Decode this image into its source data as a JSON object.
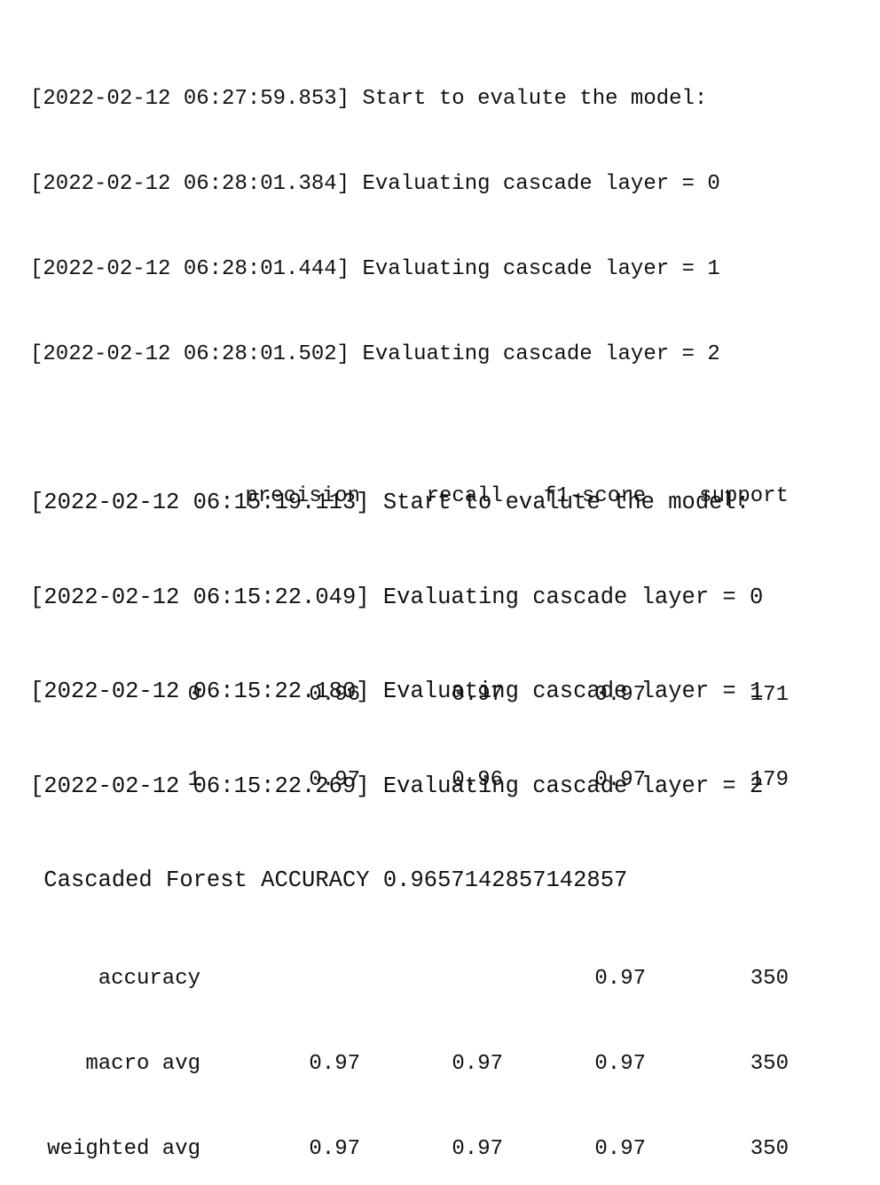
{
  "run1": {
    "log_lines": [
      {
        "timestamp": "[2022-02-12 06:27:59.853]",
        "message": "Start to evalute the model:"
      },
      {
        "timestamp": "[2022-02-12 06:28:01.384]",
        "message": "Evaluating cascade layer = 0"
      },
      {
        "timestamp": "[2022-02-12 06:28:01.444]",
        "message": "Evaluating cascade layer = 1"
      },
      {
        "timestamp": "[2022-02-12 06:28:01.502]",
        "message": "Evaluating cascade layer = 2"
      }
    ],
    "report": {
      "headers": {
        "precision": "precision",
        "recall": "recall",
        "f1": "f1-score",
        "support": "support"
      },
      "class_rows": [
        {
          "label": "0",
          "precision": "0.96",
          "recall": "0.97",
          "f1": "0.97",
          "support": "171"
        },
        {
          "label": "1",
          "precision": "0.97",
          "recall": "0.96",
          "f1": "0.97",
          "support": "179"
        }
      ],
      "summary_rows": [
        {
          "label": "accuracy",
          "precision": "",
          "recall": "",
          "f1": "0.97",
          "support": "350"
        },
        {
          "label": "macro avg",
          "precision": "0.97",
          "recall": "0.97",
          "f1": "0.97",
          "support": "350"
        },
        {
          "label": "weighted avg",
          "precision": "0.97",
          "recall": "0.97",
          "f1": "0.97",
          "support": "350"
        }
      ]
    }
  },
  "run2": {
    "log_lines": [
      {
        "timestamp": "[2022-02-12 06:15:19.113]",
        "message": "Start to evalute the model:"
      },
      {
        "timestamp": "[2022-02-12 06:15:22.049]",
        "message": "Evaluating cascade layer = 0"
      },
      {
        "timestamp": "[2022-02-12 06:15:22.180]",
        "message": "Evaluating cascade layer = 1"
      },
      {
        "timestamp": "[2022-02-12 06:15:22.269]",
        "message": "Evaluating cascade layer = 2"
      }
    ],
    "accuracy_label": " Cascaded Forest ACCURACY",
    "accuracy_value": "0.9657142857142857"
  }
}
